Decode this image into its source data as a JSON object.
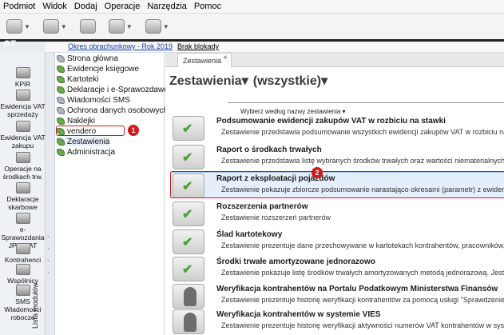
{
  "menubar": [
    "Podmiot",
    "Widok",
    "Dodaj",
    "Operacje",
    "Narzędzia",
    "Pomoc"
  ],
  "toolbar_icons": [
    "folder-icon",
    "mail-icon",
    "money-icon",
    "checklist-icon",
    "help-icon"
  ],
  "logo": "GT",
  "period_link": "Okres obrachunkowy - Rok 2019",
  "blocks_link": "Brak blokady",
  "left_nav": [
    "KPiR",
    "Ewidencja VAT sprzedaży",
    "Ewidencja VAT zakupu",
    "Operacje na środkach trw.",
    "Deklaracje skarbowe",
    "e-Sprawozdania JPK_VAT",
    "Kontrahenci",
    "Wspólnicy",
    "SMS Wiadomości robocze"
  ],
  "modules_label": "Lista modułów",
  "tree": [
    {
      "label": "Strona główna",
      "icon": "home-icon"
    },
    {
      "label": "Ewidencje księgowe",
      "icon": "leaf-icon"
    },
    {
      "label": "Kartoteki",
      "icon": "leaf-icon"
    },
    {
      "label": "Deklaracje i e-Sprawozdawczość",
      "icon": "leaf-icon"
    },
    {
      "label": "Wiadomości SMS",
      "icon": "leaf-icon"
    },
    {
      "label": "Ochrona danych osobowych",
      "icon": "leaf-icon"
    },
    {
      "label": "Naklejki",
      "icon": "leaf-icon"
    },
    {
      "label": "vendero",
      "icon": "leaf-icon"
    },
    {
      "label": "Zestawienia",
      "icon": "leaf-icon"
    },
    {
      "label": "Administracja",
      "icon": "leaf-icon"
    }
  ],
  "badge1": "1",
  "badge2": "2",
  "tab": {
    "label": "Zestawienia",
    "close": "×"
  },
  "main": {
    "heading": "Zestawienia▾",
    "filter": "(wszystkie)▾",
    "sort": "Wybierz według nazwy zestawienia ▾"
  },
  "reports": [
    {
      "title": "Podsumowanie ewidencji zakupów VAT w rozbiciu na stawki",
      "desc": "Zestawienie przedstawia podsumowanie wszystkich ewidencji zakupów VAT w rozbiciu na stawki VAT.",
      "icon": "table-icon"
    },
    {
      "title": "Raport o środkach trwałych",
      "desc": "Zestawienie przedstawia listę wybranych środków trwałych oraz wartości niematerialnych i prawnych.",
      "icon": "check-icon"
    },
    {
      "title": "Raport z eksploatacji pojazdów",
      "desc": "Zestawienie pokazuje zbiorcze podsumowanie narastająco okresami (parametr) z ewidencji przejazdów",
      "icon": "check-icon"
    },
    {
      "title": "Rozszerzenia partnerów",
      "desc": "Zestawienie rozszerzeń partnerów",
      "icon": "sql-icon"
    },
    {
      "title": "Ślad kartotekowy",
      "desc": "Zestawienie prezentuje dane przechowywane w kartotekach kontrahentów, pracowników, wspólników",
      "icon": "sql-icon"
    },
    {
      "title": "Środki trwałe amortyzowane jednorazowo",
      "desc": "Zestawienie pokazuje listę środków trwałych amortyzowanych metodą jednorazową. Jest pomocne w us",
      "icon": "check-icon"
    },
    {
      "title": "Weryfikacja kontrahentów na Portalu Podatkowym Ministerstwa Finansów",
      "desc": "Zestawienie prezentuje historię weryfikacji kontrahentów za pomocą usługi \"Sprawdzenie statusu pod",
      "icon": "user-icon"
    },
    {
      "title": "Weryfikacja kontrahentów w systemie VIES",
      "desc": "Zestawienie prezentuje historię weryfikacji aktywności numerów VAT kontrahentów w systemie VIES.",
      "icon": "user-icon"
    }
  ]
}
